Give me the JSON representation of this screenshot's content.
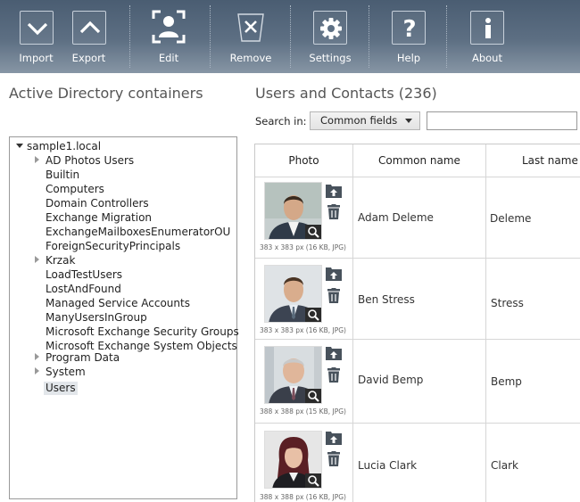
{
  "toolbar": {
    "import": "Import",
    "export": "Export",
    "edit": "Edit",
    "remove": "Remove",
    "settings": "Settings",
    "help": "Help",
    "about": "About"
  },
  "left_panel": {
    "title": "Active Directory containers",
    "tree": {
      "root": "sample1.local",
      "items": [
        "AD Photos Users",
        "Builtin",
        "Computers",
        "Domain Controllers",
        "Exchange Migration",
        "ExchangeMailboxesEnumeratorOU",
        "ForeignSecurityPrincipals",
        "Krzak",
        "LoadTestUsers",
        "LostAndFound",
        "Managed Service Accounts",
        "ManyUsersInGroup",
        "Microsoft Exchange Security Groups",
        "Microsoft Exchange System Objects",
        "Program Data",
        "System",
        "Users"
      ],
      "expandable": [
        "AD Photos Users",
        "Krzak",
        "Program Data",
        "System"
      ],
      "selected": "Users"
    }
  },
  "right_panel": {
    "title": "Users and Contacts (236)",
    "search": {
      "label": "Search in:",
      "selected": "Common fields",
      "value": ""
    },
    "columns": [
      "Photo",
      "Common name",
      "Last name"
    ],
    "rows": [
      {
        "caption": "383 x 383 px (16 KB, JPG)",
        "common_name": "Adam Deleme",
        "last_name": "Deleme"
      },
      {
        "caption": "383 x 383 px (16 KB, JPG)",
        "common_name": "Ben Stress",
        "last_name": "Stress"
      },
      {
        "caption": "388 x 388 px (15 KB, JPG)",
        "common_name": "David Bemp",
        "last_name": "Bemp"
      },
      {
        "caption": "388 x 388 px (16 KB, JPG)",
        "common_name": "Lucia Clark",
        "last_name": "Clark"
      }
    ]
  },
  "colors": {
    "toolbar_top": "#4a5d72",
    "toolbar_bottom": "#8796a5",
    "selection": "#e2e6ea",
    "icon_dark": "#48525c"
  }
}
